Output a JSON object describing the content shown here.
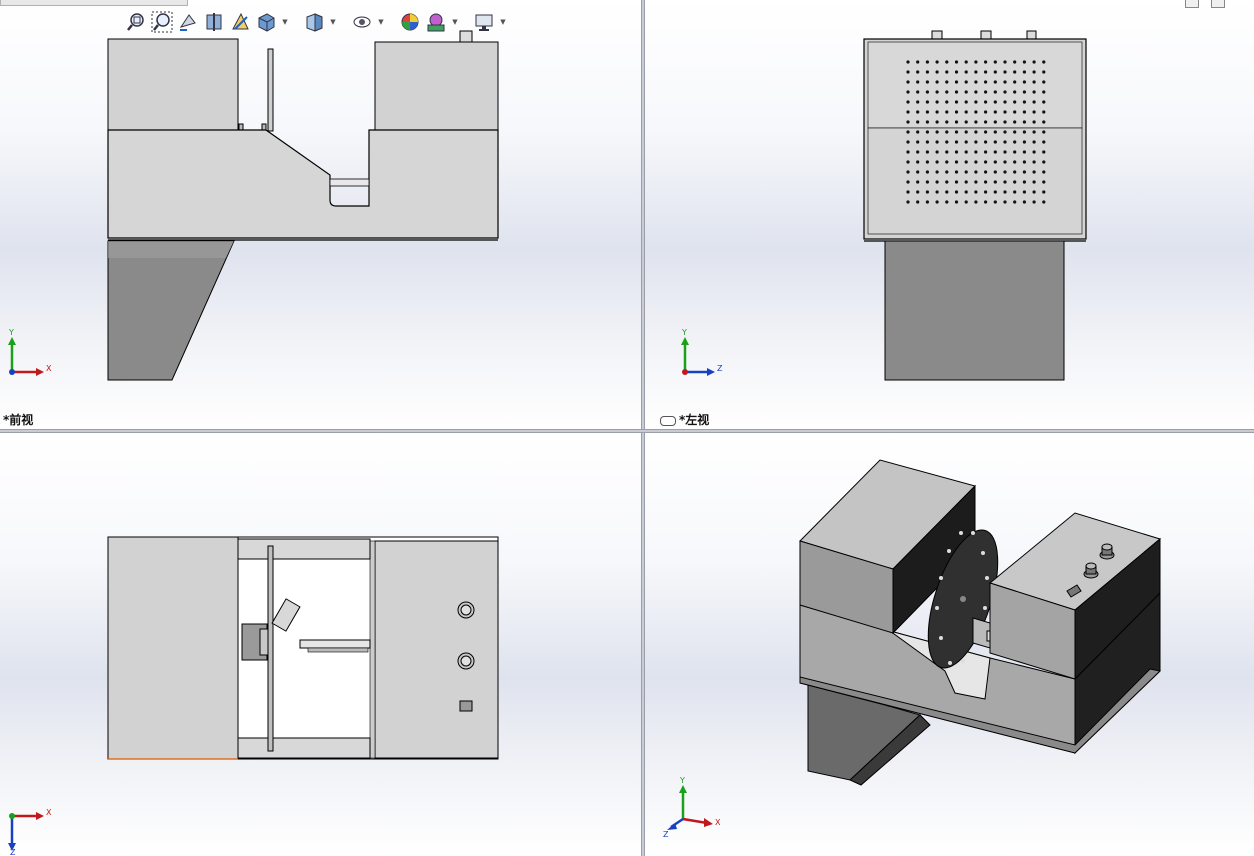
{
  "menu": {
    "tab_label": "···"
  },
  "toolbar": {
    "icons": [
      "zoom-to-fit-icon",
      "zoom-to-area-icon",
      "previous-view-icon",
      "section-view-icon",
      "dynamic-annotation-icon",
      "view-orientation-icon",
      "display-style-icon",
      "hide-show-items-icon",
      "edit-appearance-icon",
      "apply-scene-icon",
      "view-settings-icon"
    ]
  },
  "views": {
    "front": {
      "label": "*前视",
      "axes": {
        "vertical": "Y",
        "horizontal": "X"
      }
    },
    "left": {
      "label": "*左视",
      "axes": {
        "vertical": "Y",
        "horizontal": "Z"
      }
    },
    "top": {
      "label": "",
      "axes": {
        "vertical": "Z",
        "horizontal": "X"
      }
    },
    "iso": {
      "label": "",
      "axes": {
        "vertical": "Y",
        "horizontal": "X",
        "depth": "Z"
      }
    }
  },
  "colors": {
    "body_light": "#d2d2d2",
    "body_mid": "#9a9a9a",
    "body_dark": "#1e1e1e",
    "edge": "#000000",
    "axis_x": "#c0181c",
    "axis_y": "#1aa01a",
    "axis_z": "#1840c0",
    "highlight_edge": "#e07020"
  }
}
